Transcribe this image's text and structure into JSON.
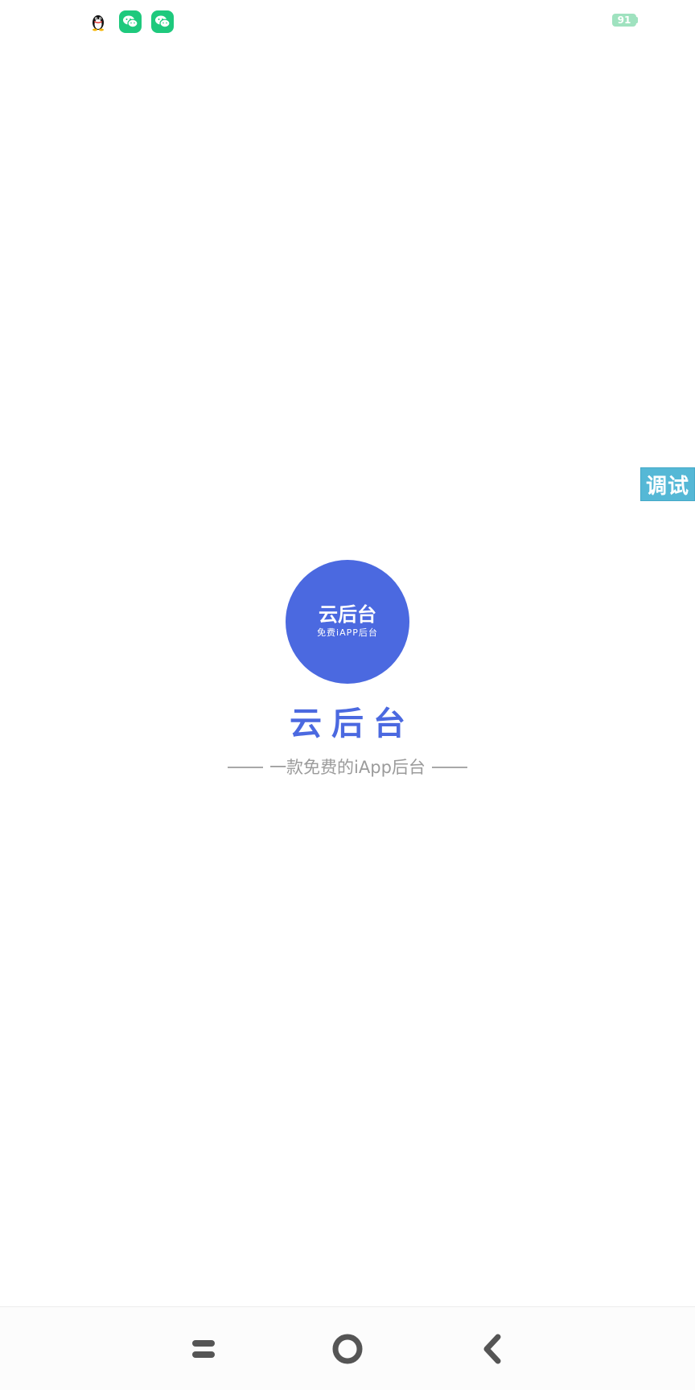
{
  "status_bar": {
    "notifications": [
      "qq-icon",
      "wechat-icon",
      "wechat-icon"
    ],
    "battery_level": "91"
  },
  "debug_badge": {
    "label": "调试"
  },
  "logo": {
    "title": "云后台",
    "subtitle": "免费iAPP后台"
  },
  "app": {
    "title": "云后台",
    "tagline": "一款免费的iApp后台"
  },
  "nav_bar": {
    "buttons": [
      "menu-icon",
      "home-icon",
      "back-icon"
    ]
  },
  "colors": {
    "brand": "#4b69e0",
    "wechat": "#1ec97d",
    "battery": "#9fe2bf",
    "debug_badge": "#55b8d6",
    "nav_icon": "#555555"
  }
}
